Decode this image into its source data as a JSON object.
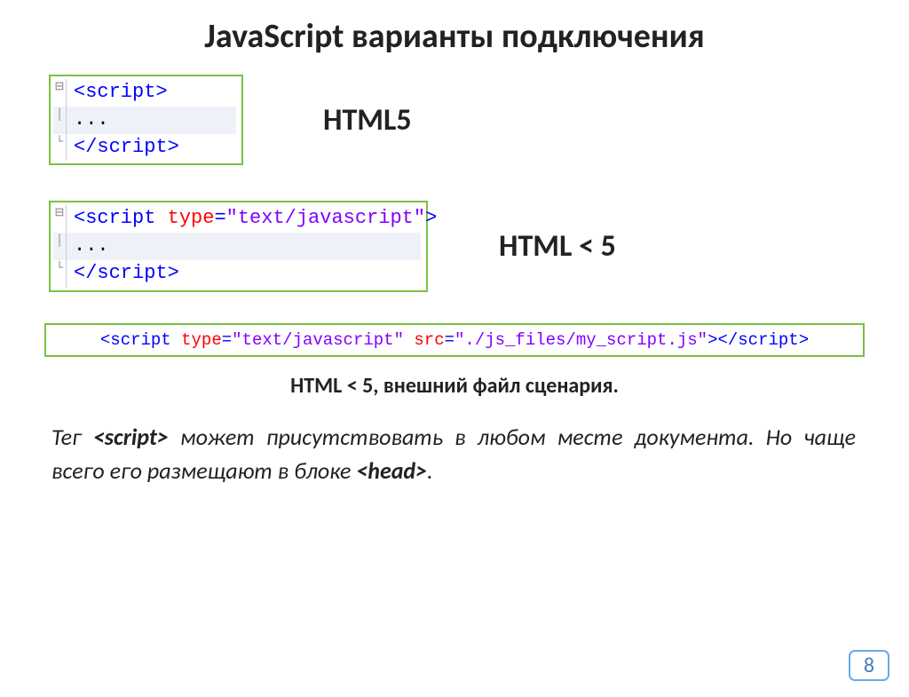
{
  "title": "JavaScript варианты подключения",
  "code1": {
    "fold_open": "⊟",
    "line1_open": "<",
    "line1_tag": "script",
    "line1_close": ">",
    "line2": "...",
    "line3_open": "</",
    "line3_tag": "script",
    "line3_close": ">"
  },
  "label1": "HTML5",
  "code2": {
    "fold_open": "⊟",
    "l1_a": "<",
    "l1_tag": "script",
    "l1_sp": " ",
    "l1_attr": "type",
    "l1_eq": "=",
    "l1_val": "\"text/javascript\"",
    "l1_b": ">",
    "l2": "...",
    "l3_a": "</",
    "l3_tag": "script",
    "l3_b": ">"
  },
  "label2": "HTML < 5",
  "code3": {
    "a": "<",
    "tag_open": "script",
    "sp1": " ",
    "attr1": "type",
    "eq1": "=",
    "val1": "\"text/javascript\"",
    "sp2": " ",
    "attr2": "src",
    "eq2": "=",
    "val2": "\"./js_files/my_script.js\"",
    "b": ">",
    "c": "</",
    "tag_close": "script",
    "d": ">"
  },
  "caption3": "HTML < 5, внешний файл сценария.",
  "body": {
    "p1a": "Тег ",
    "p1b": "<script>",
    "p1c": " может присутствовать в любом месте документа. Но чаще всего его размещают в блоке ",
    "p1d": "<head>",
    "p1e": "."
  },
  "page": "8"
}
